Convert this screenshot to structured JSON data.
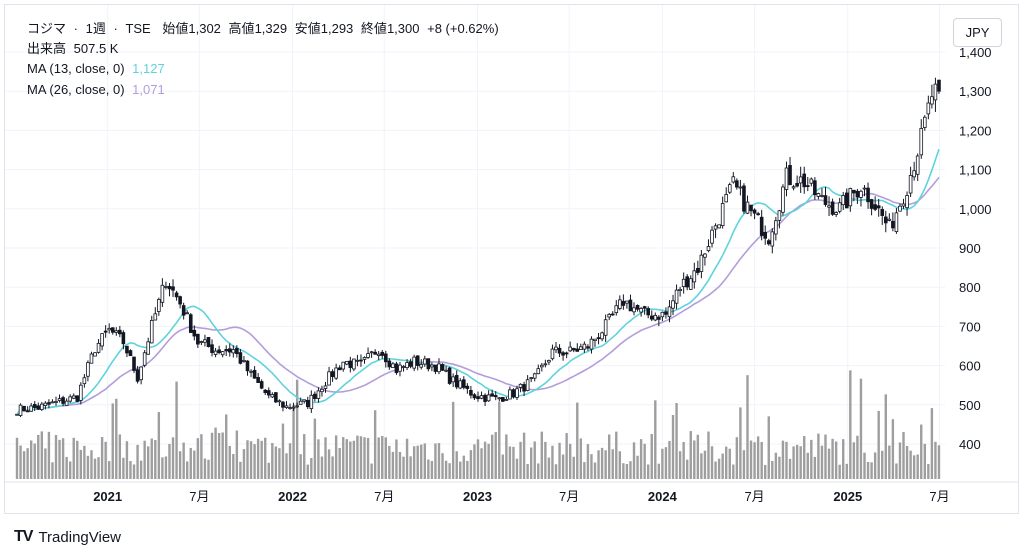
{
  "legend": {
    "symbol": "コジマ",
    "sep1": "·",
    "interval": "1週",
    "sep2": "·",
    "exchange": "TSE",
    "open_label": "始値",
    "open": "1,302",
    "high_label": "高値",
    "high": "1,329",
    "low_label": "安値",
    "low": "1,293",
    "close_label": "終値",
    "close": "1,300",
    "change": "+8 (+0.62%)",
    "volume_label": "出来高",
    "volume": "507.5 K",
    "ma13_label": "MA (13, close, 0)",
    "ma13_value": "1,127",
    "ma26_label": "MA (26, close, 0)",
    "ma26_value": "1,071"
  },
  "currency": "JPY",
  "brand": {
    "logo": "TV",
    "name": "TradingView"
  },
  "colors": {
    "ma13": "#5ed3dc",
    "ma26": "#b39ddb",
    "candle": "#131722",
    "volume": "#9e9e9e",
    "grid": "#f0f3fa"
  },
  "chart_data": {
    "type": "candlestick",
    "title": "コジマ · 1週 · TSE",
    "currency": "JPY",
    "yticks": [
      "1,400",
      "1,300",
      "1,200",
      "1,100",
      "1,000",
      "900",
      "800",
      "700",
      "600",
      "500",
      "400"
    ],
    "ylim": [
      330,
      1410
    ],
    "xticks": [
      {
        "label": "2021",
        "year": true
      },
      {
        "label": "7月",
        "year": false
      },
      {
        "label": "2022",
        "year": true
      },
      {
        "label": "7月",
        "year": false
      },
      {
        "label": "2023",
        "year": true
      },
      {
        "label": "7月",
        "year": false
      },
      {
        "label": "2024",
        "year": true
      },
      {
        "label": "7月",
        "year": false
      },
      {
        "label": "2025",
        "year": true
      },
      {
        "label": "7月",
        "year": false
      }
    ],
    "xrange": [
      "2020-07",
      "2025-07"
    ],
    "price_anchors": [
      [
        "2020-07-06",
        488
      ],
      [
        "2020-08-17",
        493
      ],
      [
        "2020-10-05",
        510
      ],
      [
        "2020-11-02",
        520
      ],
      [
        "2020-12-07",
        645
      ],
      [
        "2021-01-04",
        690
      ],
      [
        "2021-02-01",
        660
      ],
      [
        "2021-03-01",
        570
      ],
      [
        "2021-03-29",
        700
      ],
      [
        "2021-04-26",
        820
      ],
      [
        "2021-05-24",
        760
      ],
      [
        "2021-06-28",
        660
      ],
      [
        "2021-08-02",
        640
      ],
      [
        "2021-09-06",
        640
      ],
      [
        "2021-10-11",
        575
      ],
      [
        "2021-11-15",
        520
      ],
      [
        "2021-12-20",
        495
      ],
      [
        "2022-01-31",
        505
      ],
      [
        "2022-03-07",
        560
      ],
      [
        "2022-04-11",
        610
      ],
      [
        "2022-05-16",
        600
      ],
      [
        "2022-06-20",
        645
      ],
      [
        "2022-07-25",
        590
      ],
      [
        "2022-08-29",
        610
      ],
      [
        "2022-10-10",
        600
      ],
      [
        "2022-11-14",
        560
      ],
      [
        "2022-12-26",
        525
      ],
      [
        "2023-02-06",
        515
      ],
      [
        "2023-03-13",
        530
      ],
      [
        "2023-04-24",
        565
      ],
      [
        "2023-05-29",
        635
      ],
      [
        "2023-07-03",
        635
      ],
      [
        "2023-08-07",
        650
      ],
      [
        "2023-09-11",
        700
      ],
      [
        "2023-10-16",
        765
      ],
      [
        "2023-11-27",
        730
      ],
      [
        "2024-01-08",
        730
      ],
      [
        "2024-02-05",
        800
      ],
      [
        "2024-03-11",
        850
      ],
      [
        "2024-04-15",
        960
      ],
      [
        "2024-05-20",
        1060
      ],
      [
        "2024-06-24",
        990
      ],
      [
        "2024-07-29",
        930
      ],
      [
        "2024-09-02",
        1080
      ],
      [
        "2024-10-07",
        1070
      ],
      [
        "2024-11-11",
        1020
      ],
      [
        "2024-12-16",
        1000
      ],
      [
        "2025-01-27",
        1060
      ],
      [
        "2025-02-24",
        1010
      ],
      [
        "2025-03-24",
        950
      ],
      [
        "2025-04-28",
        1060
      ],
      [
        "2025-05-26",
        1180
      ],
      [
        "2025-06-16",
        1290
      ],
      [
        "2025-06-30",
        1300
      ]
    ],
    "last_candle": {
      "open": 1302,
      "high": 1329,
      "low": 1293,
      "close": 1300
    },
    "last_volume": 507500,
    "series": [
      {
        "name": "MA (13, close, 0)",
        "last": 1127
      },
      {
        "name": "MA (26, close, 0)",
        "last": 1071
      }
    ]
  }
}
